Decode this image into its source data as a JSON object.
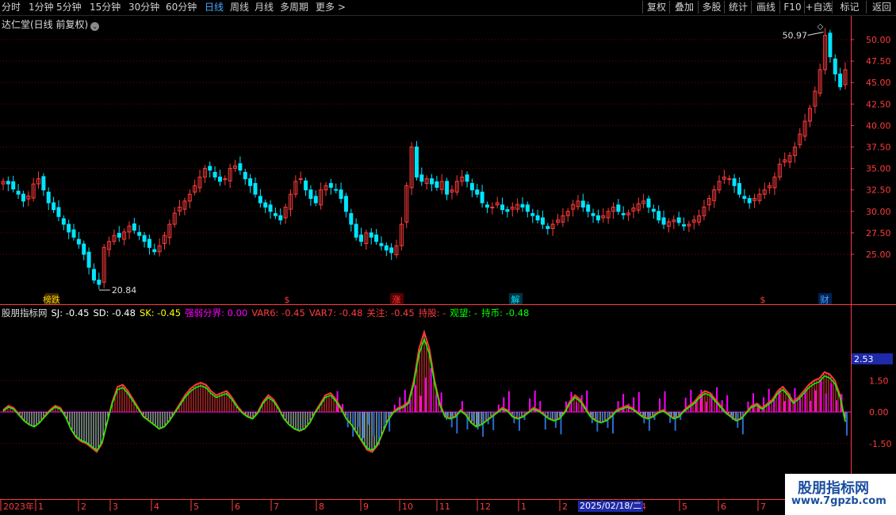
{
  "toolbar": {
    "tabs": [
      "分时",
      "1分钟",
      "5分钟",
      "15分钟",
      "30分钟",
      "60分钟",
      "日线",
      "周线",
      "月线",
      "多周期",
      "更多 >"
    ],
    "active_tab": "日线",
    "right_buttons": [
      "复权",
      "叠加",
      "多股",
      "统计",
      "画线",
      "F10",
      "+自选",
      "标记",
      "返回"
    ]
  },
  "main_title": "达仁堂(日线 前复权)",
  "indicator": {
    "name": "股朋指标网",
    "items": [
      {
        "label": "SJ: -0.45",
        "color": "#ffffff"
      },
      {
        "label": "SD: -0.48",
        "color": "#ffffff"
      },
      {
        "label": "SK: -0.45",
        "color": "#ffff00"
      },
      {
        "label": "强弱分界: 0.00",
        "color": "#ff00ff"
      },
      {
        "label": "VAR6: -0.45",
        "color": "#ff3b3b"
      },
      {
        "label": "VAR7: -0.48",
        "color": "#ff3b3b"
      },
      {
        "label": "关注: -0.45",
        "color": "#ff3b3b"
      },
      {
        "label": "持股: -",
        "color": "#ff3b3b"
      },
      {
        "label": "观望: -",
        "color": "#00ff00"
      },
      {
        "label": "持币: -0.48",
        "color": "#00ff00"
      }
    ]
  },
  "markers": {
    "high_label": "50.97",
    "low_label": "20.84",
    "events": [
      "榜跌",
      "$",
      "涨",
      "解",
      "$",
      "财"
    ]
  },
  "cursor_date": "2025/02/18/二",
  "watermark": {
    "line1": "股朋指标网",
    "line2": "www.7gpzb.com"
  },
  "colors": {
    "up": "#ff3b3b",
    "down": "#00e5ff",
    "grid": "#7a0000",
    "axis": "#ff3b3b",
    "green": "#00ff00",
    "magenta": "#ff00ff",
    "blue": "#2d6ccf"
  },
  "chart_data": [
    {
      "type": "candlestick",
      "title": "达仁堂(日线 前复权)",
      "y_ticks": [
        25.0,
        27.5,
        30.0,
        32.5,
        35.0,
        37.5,
        40.0,
        42.5,
        45.0,
        47.5,
        50.0
      ],
      "ylim": [
        20.0,
        52.0
      ],
      "high": 50.97,
      "low": 20.84,
      "close_series": [
        33.5,
        33.2,
        32.6,
        32.0,
        31.2,
        31.8,
        33.2,
        33.8,
        32.5,
        31.0,
        30.2,
        29.4,
        28.5,
        27.6,
        27.0,
        26.2,
        25.0,
        23.5,
        22.0,
        21.5,
        25.8,
        26.5,
        27.2,
        27.0,
        27.6,
        28.3,
        27.8,
        27.2,
        26.5,
        25.8,
        25.3,
        26.0,
        27.2,
        28.5,
        29.8,
        30.5,
        31.2,
        32.0,
        33.0,
        34.0,
        35.0,
        34.8,
        34.0,
        33.5,
        33.8,
        35.0,
        35.3,
        34.8,
        33.8,
        33.0,
        32.0,
        31.0,
        30.5,
        30.0,
        29.5,
        29.0,
        30.5,
        32.0,
        33.5,
        33.8,
        32.5,
        31.5,
        31.0,
        32.5,
        33.0,
        32.8,
        32.5,
        31.5,
        30.0,
        28.5,
        27.0,
        26.5,
        27.5,
        27.0,
        26.5,
        26.0,
        25.5,
        25.2,
        26.0,
        28.5,
        33.0,
        37.5,
        34.0,
        33.5,
        33.8,
        33.2,
        32.8,
        33.5,
        32.0,
        32.5,
        33.5,
        34.0,
        33.5,
        32.5,
        32.0,
        31.0,
        30.5,
        30.5,
        31.0,
        30.2,
        30.0,
        30.5,
        30.8,
        30.5,
        30.0,
        29.5,
        29.0,
        28.5,
        28.0,
        28.5,
        29.0,
        29.5,
        30.0,
        30.8,
        31.2,
        30.5,
        30.0,
        29.5,
        29.0,
        29.5,
        30.0,
        30.5,
        30.0,
        29.6,
        29.8,
        30.4,
        30.9,
        31.2,
        30.5,
        30.0,
        29.0,
        28.5,
        28.8,
        29.0,
        28.7,
        28.3,
        28.5,
        29.0,
        29.5,
        30.5,
        31.5,
        32.5,
        33.5,
        34.0,
        33.8,
        33.0,
        32.0,
        31.5,
        31.0,
        31.5,
        32.0,
        32.5,
        33.0,
        34.0,
        35.5,
        36.0,
        36.5,
        37.5,
        39.0,
        40.5,
        42.0,
        44.0,
        46.5,
        50.5,
        48.0,
        46.0,
        44.5,
        46.5
      ],
      "event_labels": [
        "榜跌",
        "$",
        "涨",
        "解",
        "$",
        "财"
      ]
    },
    {
      "type": "bar",
      "title": "股朋指标网",
      "y_ticks": [
        -1.5,
        0.0,
        1.5
      ],
      "current_value": 2.53,
      "series": [
        {
          "name": "SJ",
          "last": -0.45
        },
        {
          "name": "SD",
          "last": -0.48
        },
        {
          "name": "SK",
          "last": -0.45
        },
        {
          "name": "强弱分界",
          "last": 0.0
        },
        {
          "name": "VAR6",
          "last": -0.45
        },
        {
          "name": "VAR7",
          "last": -0.48
        }
      ],
      "wave": [
        0.1,
        0.3,
        0.2,
        -0.1,
        -0.4,
        -0.6,
        -0.7,
        -0.5,
        -0.2,
        0.1,
        0.3,
        0.2,
        -0.2,
        -0.8,
        -1.2,
        -1.4,
        -1.5,
        -1.7,
        -1.9,
        -1.5,
        -0.5,
        0.5,
        1.2,
        1.3,
        1.0,
        0.6,
        0.2,
        -0.2,
        -0.4,
        -0.6,
        -0.8,
        -0.7,
        -0.4,
        0.0,
        0.4,
        0.8,
        1.1,
        1.3,
        1.4,
        1.3,
        1.0,
        0.8,
        0.9,
        1.0,
        0.7,
        0.3,
        0.0,
        -0.2,
        -0.3,
        0.0,
        0.5,
        0.8,
        0.6,
        0.2,
        -0.3,
        -0.6,
        -0.8,
        -0.9,
        -0.8,
        -0.5,
        0.0,
        0.4,
        0.8,
        0.9,
        0.6,
        0.2,
        -0.3,
        -0.6,
        -1.0,
        -1.4,
        -1.8,
        -1.9,
        -1.6,
        -1.0,
        -0.4,
        0.0,
        0.2,
        0.3,
        0.5,
        1.5,
        3.0,
        3.8,
        3.0,
        1.5,
        0.4,
        -0.2,
        -0.3,
        -0.2,
        0.1,
        -0.1,
        -0.5,
        -0.7,
        -0.6,
        -0.4,
        -0.2,
        0.0,
        0.2,
        0.1,
        -0.2,
        -0.3,
        -0.2,
        0.0,
        0.2,
        0.1,
        -0.1,
        -0.3,
        -0.4,
        -0.3,
        0.0,
        0.5,
        0.8,
        0.6,
        0.2,
        -0.2,
        -0.4,
        -0.5,
        -0.4,
        -0.2,
        0.1,
        0.2,
        0.3,
        0.2,
        0.0,
        -0.2,
        -0.3,
        -0.2,
        0.0,
        0.1,
        -0.1,
        -0.3,
        -0.2,
        0.1,
        0.3,
        0.5,
        0.8,
        1.0,
        0.9,
        0.6,
        0.3,
        0.0,
        -0.2,
        -0.4,
        -0.3,
        0.0,
        0.3,
        0.4,
        0.2,
        0.4,
        0.6,
        1.0,
        1.2,
        0.9,
        0.5,
        0.7,
        1.0,
        1.3,
        1.5,
        1.6,
        1.9,
        1.8,
        1.5,
        0.8,
        -0.45
      ]
    }
  ],
  "x_axis_labels": [
    "2023年",
    "1",
    "2",
    "3",
    "4",
    "5",
    "6",
    "7",
    "8",
    "9",
    "10",
    "11",
    "12",
    "1",
    "2",
    "3",
    "4",
    "5",
    "6",
    "7"
  ]
}
